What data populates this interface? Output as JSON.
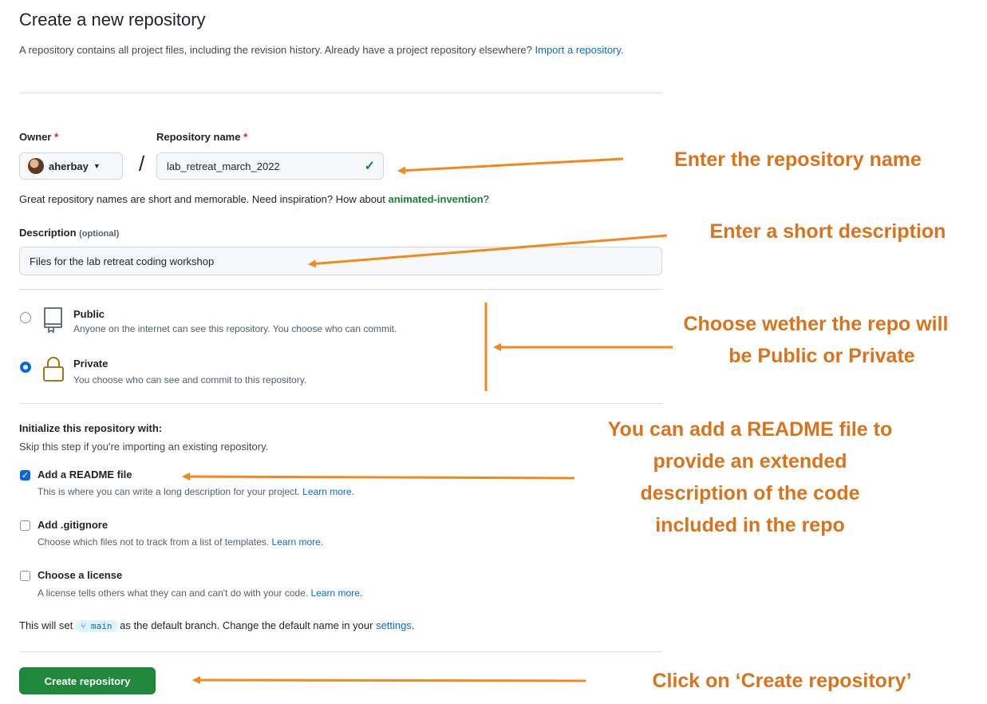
{
  "page": {
    "title": "Create a new repository",
    "subtitle_text": "A repository contains all project files, including the revision history. Already have a project repository elsewhere?",
    "import_link": "Import a repository."
  },
  "owner": {
    "label": "Owner",
    "required_mark": "*",
    "value": "aherbay"
  },
  "repo_name": {
    "label": "Repository name",
    "required_mark": "*",
    "value": "lab_retreat_march_2022",
    "slash": "/"
  },
  "name_hint": {
    "text": "Great repository names are short and memorable. Need inspiration? How about",
    "suggestion": "animated-invention",
    "end": "?"
  },
  "description": {
    "label": "Description",
    "optional": "(optional)",
    "value": "Files for the lab retreat coding workshop"
  },
  "visibility": {
    "options": [
      {
        "title": "Public",
        "subtitle": "Anyone on the internet can see this repository. You choose who can commit.",
        "selected": false
      },
      {
        "title": "Private",
        "subtitle": "You choose who can see and commit to this repository.",
        "selected": true
      }
    ]
  },
  "initialize": {
    "heading": "Initialize this repository with:",
    "sub": "Skip this step if you're importing an existing repository.",
    "items": [
      {
        "title": "Add a README file",
        "subtitle": "This is where you can write a long description for your project.",
        "learn": "Learn more.",
        "checked": true
      },
      {
        "title": "Add .gitignore",
        "subtitle": "Choose which files not to track from a list of templates.",
        "learn": "Learn more.",
        "checked": false
      },
      {
        "title": "Choose a license",
        "subtitle": "A license tells others what they can and can't do with your code.",
        "learn": "Learn more.",
        "checked": false
      }
    ]
  },
  "branch": {
    "prefix": "This will set",
    "name": "main",
    "middle": "as the default branch. Change the default name in your",
    "link": "settings",
    "end": "."
  },
  "create_button": "Create repository",
  "annotations": {
    "name": "Enter the repository name",
    "description": "Enter a short description",
    "visibility_1": "Choose wether the repo will",
    "visibility_2": "be Public or Private",
    "readme_1": "You can add a README file to",
    "readme_2": "provide an extended",
    "readme_3": "description of the code",
    "readme_4": "included in the repo",
    "create": "Click on ‘Create repository’"
  },
  "colors": {
    "annotation": "#d9731c",
    "arrow": "#f08a1c",
    "primary_button": "#1f883d",
    "link": "#0969da"
  }
}
